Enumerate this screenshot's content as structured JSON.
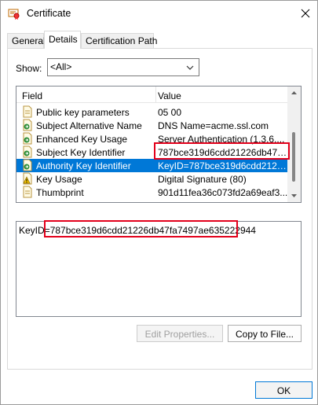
{
  "window": {
    "title": "Certificate",
    "close_glyph": "✕"
  },
  "tabs": [
    {
      "label": "General"
    },
    {
      "label": "Details"
    },
    {
      "label": "Certification Path"
    }
  ],
  "show": {
    "label": "Show:",
    "selected": "<All>"
  },
  "list": {
    "headers": {
      "field": "Field",
      "value": "Value"
    },
    "rows": [
      {
        "field": "Public key parameters",
        "value": "05 00",
        "icon": "document-icon"
      },
      {
        "field": "Subject Alternative Name",
        "value": "DNS Name=acme.ssl.com",
        "icon": "extension-icon"
      },
      {
        "field": "Enhanced Key Usage",
        "value": "Server Authentication (1.3.6....",
        "icon": "extension-icon"
      },
      {
        "field": "Subject Key Identifier",
        "value": "787bce319d6cdd21226db47fa...",
        "icon": "extension-icon"
      },
      {
        "field": "Authority Key Identifier",
        "value": "KeyID=787bce319d6cdd2122...",
        "icon": "extension-icon",
        "selected": true
      },
      {
        "field": "Key Usage",
        "value": "Digital Signature (80)",
        "icon": "warning-extension-icon"
      },
      {
        "field": "Thumbprint",
        "value": "901d11fea36c073fd2a69eaf3...",
        "icon": "document-icon"
      }
    ]
  },
  "detail": {
    "prefix": "KeyID",
    "rest": "=787bce319d6cdd21226db47fa7497ae635222944"
  },
  "buttons": {
    "edit_properties": "Edit Properties...",
    "copy_to_file": "Copy to File...",
    "ok": "OK"
  },
  "colors": {
    "selection": "#0078d7",
    "highlight": "#e3001b"
  }
}
